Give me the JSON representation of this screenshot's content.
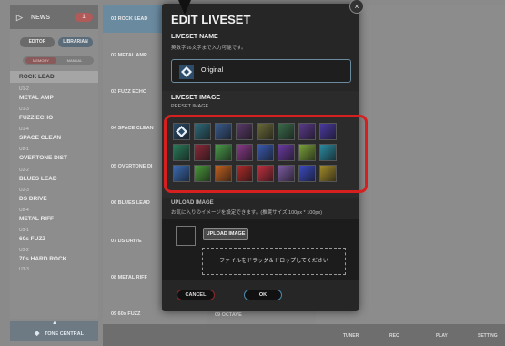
{
  "news": {
    "label": "NEWS",
    "badge": "1"
  },
  "mode_tabs": {
    "editor": "EDITOR",
    "librarian": "LIBRARIAN"
  },
  "memory_toggle": {
    "memory": "MEMORY",
    "manual": "MANUAL"
  },
  "sidebar_items": [
    {
      "num": "",
      "name": "ROCK LEAD"
    },
    {
      "num": "U1-2",
      "name": "METAL AMP"
    },
    {
      "num": "U1-3",
      "name": "FUZZ ECHO"
    },
    {
      "num": "U1-4",
      "name": "SPACE CLEAN"
    },
    {
      "num": "U2-1",
      "name": "OVERTONE DIST"
    },
    {
      "num": "U2-2",
      "name": "BLUES LEAD"
    },
    {
      "num": "U2-3",
      "name": "DS DRIVE"
    },
    {
      "num": "U2-4",
      "name": "METAL RIFF"
    },
    {
      "num": "U3-1",
      "name": "60s FUZZ"
    },
    {
      "num": "U3-2",
      "name": "70s HARD ROCK"
    },
    {
      "num": "U3-3",
      "name": ""
    }
  ],
  "tone_central": "TONE CENTRAL",
  "patch_list": [
    "01  ROCK LEAD",
    "02  METAL AMP",
    "03  FUZZ ECHO",
    "04  SPACE CLEAN",
    "05  OVERTONE DI",
    "06  BLUES LEAD",
    "07  DS DRIVE",
    "08  METAL RIFF",
    "09  60s FUZZ"
  ],
  "octave_item": "09  OCTAVE",
  "bottom_bar": {
    "tuner": "TUNER",
    "rec": "REC",
    "play": "PLAY",
    "setting": "SETTING"
  },
  "dialog": {
    "title": "EDIT LIVESET",
    "close": "×",
    "name_section": {
      "heading": "LIVESET NAME",
      "sub": "英数字16文字まで入力可能です。",
      "value": "Original"
    },
    "image_section": {
      "heading": "LIVESET IMAGE",
      "sub": "PRESET IMAGE"
    },
    "upload_section": {
      "heading": "UPLOAD IMAGE",
      "sub": "お気に入りのイメージを設定できます。(推奨サイズ 100px * 100px)",
      "button": "UPLOAD IMAGE",
      "drop_hint": "ファイルをドラッグ＆ドロップしてください"
    },
    "cancel": "CANCEL",
    "ok": "OK"
  },
  "preset_tiles": [
    {
      "name": "tile-diamond-logo",
      "bg": "#2a4a66"
    },
    {
      "name": "tile-teal-gradient",
      "bg": "#2f6a7a"
    },
    {
      "name": "tile-blue-gradient",
      "bg": "#3a5a8a"
    },
    {
      "name": "tile-purple",
      "bg": "#5a3a6a"
    },
    {
      "name": "tile-olive",
      "bg": "#6a6a3a"
    },
    {
      "name": "tile-green",
      "bg": "#3a6a4a"
    },
    {
      "name": "tile-purple-light",
      "bg": "#5a3a8a"
    },
    {
      "name": "tile-violet-swirl",
      "bg": "#4a3aa0"
    },
    {
      "name": "tile-green-burst",
      "bg": "#2a7a5a"
    },
    {
      "name": "tile-red-stripes",
      "bg": "#8a2a3a"
    },
    {
      "name": "tile-green-light",
      "bg": "#4a9a4a"
    },
    {
      "name": "tile-magenta-glow",
      "bg": "#8a3a8a"
    },
    {
      "name": "tile-blue-abstract",
      "bg": "#3a5ab0"
    },
    {
      "name": "tile-purple-waves",
      "bg": "#6a3aa0"
    },
    {
      "name": "tile-lime-waves",
      "bg": "#7aa03a"
    },
    {
      "name": "tile-cyan-light",
      "bg": "#2a8aa0"
    },
    {
      "name": "tile-blue-wave",
      "bg": "#3a6ab0"
    },
    {
      "name": "tile-green-wave",
      "bg": "#4a9a3a"
    },
    {
      "name": "tile-orange-fire",
      "bg": "#c06020"
    },
    {
      "name": "tile-red-fire",
      "bg": "#b02a2a"
    },
    {
      "name": "tile-red-sparkle",
      "bg": "#c03040"
    },
    {
      "name": "tile-rainbow-stripes",
      "bg": "#7a5aa0"
    },
    {
      "name": "tile-blue-stripes",
      "bg": "#3a4ac0"
    },
    {
      "name": "tile-gold-stripes",
      "bg": "#a08a2a"
    }
  ]
}
